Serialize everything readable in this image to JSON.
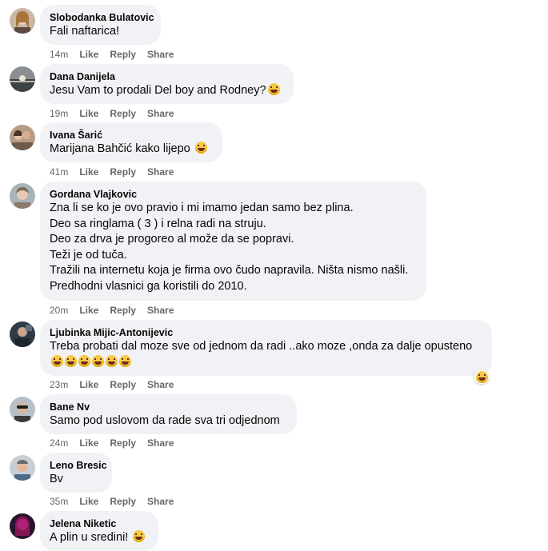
{
  "comments": [
    {
      "author": "Slobodanka Bulatovic",
      "lines": [
        "Fali naftarica!"
      ],
      "time": "14m",
      "avatar": "portrait-woman-blonde"
    },
    {
      "author": "Dana Danijela",
      "lines": [
        "Jesu Vam to prodali Del boy and Rodney?"
      ],
      "time": "19m",
      "avatar": "sunset-landscape"
    },
    {
      "author": "Ivana Šarić",
      "mention": "Marijana Bahčić",
      "lines": [
        " kako lijepo "
      ],
      "time": "41m",
      "avatar": "portrait-couple"
    },
    {
      "author": "Gordana Vlajkovic",
      "lines": [
        "Zna li se ko je ovo pravio i mi imamo jedan samo bez plina.",
        "Deo sa ringlama ( 3 ) i relna radi na struju.",
        "Deo za drva je progoreo al može da se popravi.",
        "Teži je od tuča.",
        "Tražili na internetu koja je firma ovo čudo napravila. Ništa nismo našli.",
        "Predhodni vlasnici ga koristili do 2010."
      ],
      "time": "20m",
      "avatar": "portrait-woman"
    },
    {
      "author": "Ljubinka Mijic-Antonijevic",
      "lines": [
        "Treba probati dal moze sve od jednom da radi ..ako moze ,onda za dalje opusteno",
        ""
      ],
      "time": "23m",
      "avatar": "portrait-man-dark"
    },
    {
      "author": "Bane Nv",
      "lines": [
        "Samo pod uslovom da rade sva tri odjednom"
      ],
      "time": "24m",
      "avatar": "portrait-man-sunglasses"
    },
    {
      "author": "Leno Bresic",
      "lines": [
        "Bv"
      ],
      "time": "35m",
      "avatar": "portrait-man-light"
    },
    {
      "author": "Jelena Niketic",
      "lines": [
        "A plin u sredini! "
      ],
      "time": "",
      "avatar": "portrait-woman-purple"
    }
  ],
  "actions": {
    "like": "Like",
    "reply": "Reply",
    "share": "Share"
  },
  "colors": {
    "bubble": "#f0f2f5",
    "meta": "#65676b",
    "text": "#050505"
  }
}
